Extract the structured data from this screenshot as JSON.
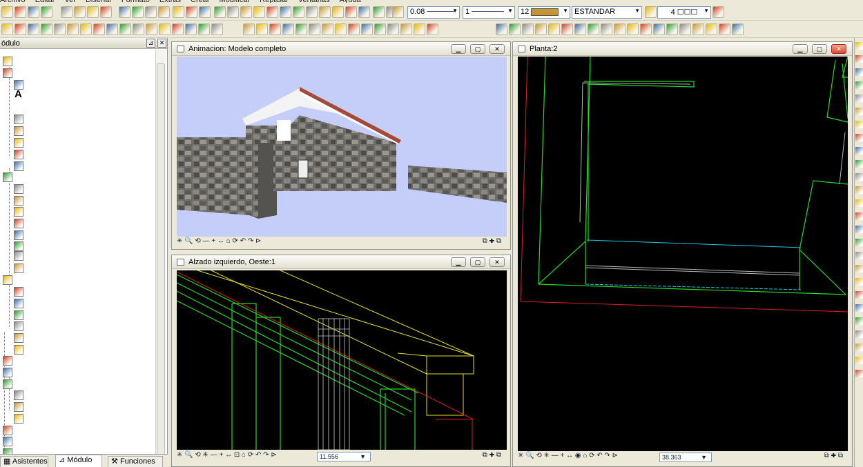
{
  "menu": [
    "Archivo",
    "Editar",
    "Ver",
    "Diseñar",
    "Formato",
    "Extras",
    "Crear",
    "Modificar",
    "Repasar",
    "Ventanas",
    "Ayuda"
  ],
  "toolbar": {
    "line_thickness": "0.08",
    "line_type": "1",
    "pen_color_number": "12",
    "layer_name": "ESTANDAR",
    "hatch_setting": "4",
    "pen_color_hex": "#c8962e"
  },
  "sidebar": {
    "title": "ódulo",
    "tabs": [
      {
        "label": "Asistentes"
      },
      {
        "label": "Módulo"
      },
      {
        "label": "Funciones"
      }
    ],
    "text_tool_label": "A"
  },
  "windows": {
    "animation": {
      "title": "Animacion: Modelo completo"
    },
    "elevation": {
      "title": "Alzado izquierdo, Oeste:1",
      "scale": "11.556"
    },
    "plan": {
      "title": "Planta:2",
      "scale": "38.363"
    }
  },
  "colors": {
    "sky": "#c4cef9",
    "cad_bg": "#000000",
    "green_line": "#22dd22",
    "yellow_line": "#e8e020",
    "red_line": "#dd2020",
    "cyan_line": "#20c8e8",
    "gray_line": "#bbbbbb"
  }
}
